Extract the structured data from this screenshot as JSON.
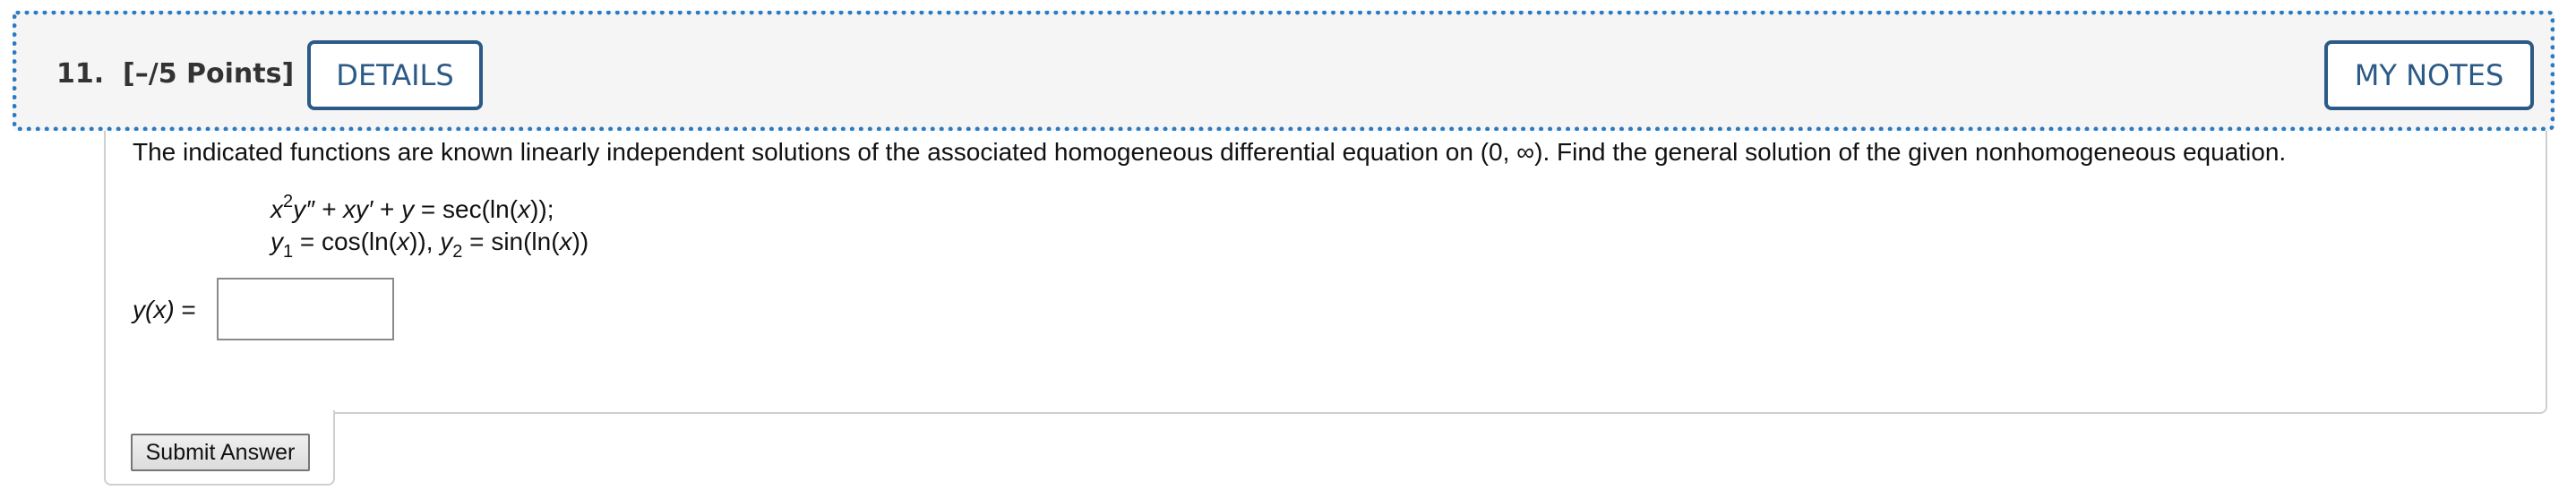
{
  "question": {
    "number": "11.",
    "points": "[–/5 Points]",
    "details_label": "DETAILS",
    "my_notes_label": "MY NOTES"
  },
  "body": {
    "prompt": "The indicated functions are known linearly independent solutions of the associated homogeneous differential equation on (0, ∞). Find the general solution of the given nonhomogeneous equation.",
    "equation_line1": {
      "x": "x",
      "exp": "2",
      "rest_a": "y″ + ",
      "rest_b": "xy′",
      "rest_c": " + ",
      "rest_d": "y",
      "rest_e": " = sec(ln(",
      "rest_f": "x",
      "rest_g": "));"
    },
    "equation_line2": {
      "y1": "y",
      "sub1": "1",
      "mid1": " = cos(ln(",
      "x1": "x",
      "mid2": ")), ",
      "y2": "y",
      "sub2": "2",
      "mid3": " = sin(ln(",
      "x2": "x",
      "end": "))"
    },
    "answer_label_fn": "y(x)",
    "answer_label_eq": " = ",
    "answer_value": ""
  },
  "submit_label": "Submit Answer",
  "colors": {
    "header_border": "#2a7bc4",
    "button_text": "#2b5a87",
    "header_bg": "#f5f5f5"
  }
}
